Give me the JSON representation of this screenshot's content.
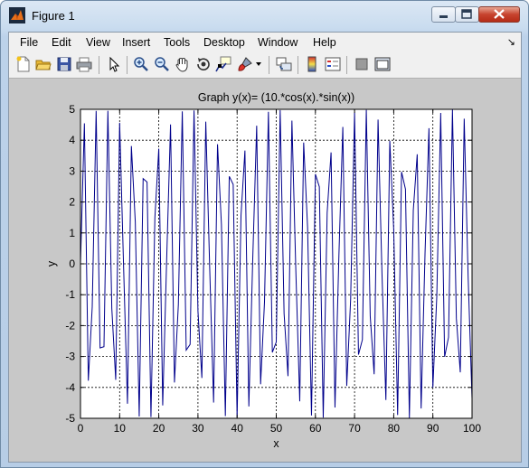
{
  "window": {
    "title": "Figure 1",
    "icon": "matlab-icon"
  },
  "menu": {
    "items": [
      "File",
      "Edit",
      "View",
      "Insert",
      "Tools",
      "Desktop",
      "Window",
      "Help"
    ],
    "dock": "↘"
  },
  "toolbar": {
    "icons": [
      "new-figure-icon",
      "open-file-icon",
      "save-icon",
      "print-icon",
      "edit-plot-arrow-icon",
      "zoom-in-icon",
      "zoom-out-icon",
      "pan-hand-icon",
      "rotate-3d-icon",
      "data-cursor-icon",
      "brush-icon",
      "link-plot-icon",
      "colorbar-icon",
      "legend-icon",
      "hide-plot-tools-icon",
      "show-plot-tools-icon"
    ]
  },
  "chart_data": {
    "type": "line",
    "title": "Graph y(x)= (10.*cos(x).*sin(x))",
    "xlabel": "x",
    "ylabel": "y",
    "xlim": [
      0,
      100
    ],
    "ylim": [
      -5,
      5
    ],
    "xticks": [
      "0",
      "10",
      "20",
      "30",
      "40",
      "50",
      "60",
      "70",
      "80",
      "90",
      "100"
    ],
    "yticks": [
      "5",
      "4",
      "3",
      "2",
      "1",
      "0",
      "-1",
      "-2",
      "-3",
      "-4",
      "-5"
    ],
    "grid": true,
    "line_color": "#00008b",
    "series": [
      {
        "x_start": 0,
        "x_end": 100,
        "x_step": 1,
        "expression": "10*cos(x)*sin(x)"
      }
    ]
  }
}
